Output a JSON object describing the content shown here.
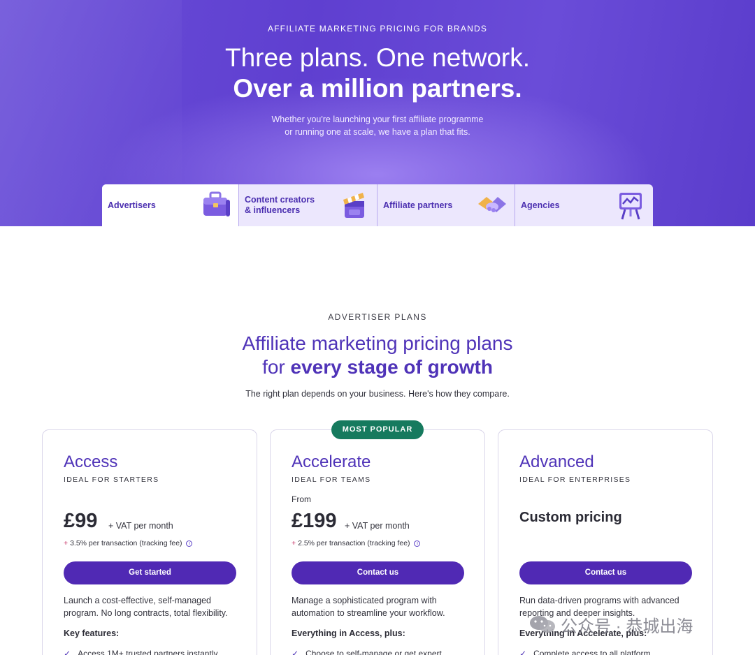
{
  "hero": {
    "eyebrow": "AFFILIATE MARKETING PRICING FOR BRANDS",
    "title_line1": "Three plans. One network.",
    "title_line2": "Over a million partners.",
    "subtitle_line1": "Whether you're launching your first affiliate programme",
    "subtitle_line2": "or running one at scale, we have a plan that fits."
  },
  "tabs": [
    {
      "label": "Advertisers",
      "icon": "briefcase-icon",
      "active": true
    },
    {
      "label_line1": "Content creators",
      "label_line2": "& influencers",
      "icon": "clapperboard-icon",
      "active": false
    },
    {
      "label": "Affiliate partners",
      "icon": "handshake-icon",
      "active": false
    },
    {
      "label": "Agencies",
      "icon": "presentation-board-icon",
      "active": false
    }
  ],
  "section": {
    "eyebrow": "ADVERTISER PLANS",
    "title_line1": "Affiliate marketing pricing plans",
    "title_line2_prefix": "for ",
    "title_line2_bold": "every stage of growth",
    "subtitle": "The right plan depends on your business. Here's how they compare."
  },
  "badge": "MOST POPULAR",
  "plans": [
    {
      "name": "Access",
      "ideal": "IDEAL FOR STARTERS",
      "price": "£99",
      "per": "+ VAT per month",
      "fee_prefix": "+",
      "fee": "3.5% per transaction (tracking fee)",
      "cta": "Get started",
      "desc": "Launch a cost-effective, self-managed program. No long contracts, total flexibility.",
      "features_title": "Key features:",
      "feature_1": "Access 1M+ trusted partners instantly"
    },
    {
      "name": "Accelerate",
      "ideal": "IDEAL FOR TEAMS",
      "from": "From",
      "price": "£199",
      "per": "+ VAT per month",
      "fee_prefix": "+",
      "fee": "2.5% per transaction (tracking fee)",
      "cta": "Contact us",
      "desc": "Manage a sophisticated program with automation to streamline your workflow.",
      "features_title": "Everything in Access, plus:",
      "feature_1": "Choose to self-manage or get expert"
    },
    {
      "name": "Advanced",
      "ideal": "IDEAL FOR ENTERPRISES",
      "price_text": "Custom pricing",
      "cta": "Contact us",
      "desc": "Run data-driven programs with advanced reporting and deeper insights.",
      "features_title": "Everything in Accelerate, plus:",
      "feature_1": "Complete access to all platform"
    }
  ],
  "watermark": {
    "text": "公众号 · 恭城出海",
    "icon": "wechat-icon"
  },
  "colors": {
    "brand_purple": "#5029b4",
    "heading_purple": "#4f33b8",
    "badge_green": "#167a5e",
    "hero_bg": "#6246d4"
  }
}
